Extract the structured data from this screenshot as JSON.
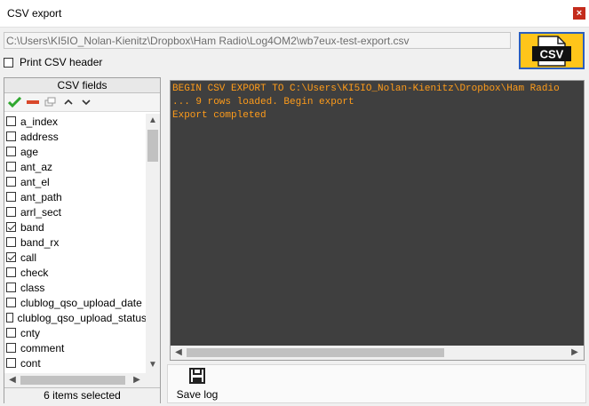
{
  "window": {
    "title": "CSV export",
    "close_glyph": "×"
  },
  "export_path": "C:\\Users\\KI5IO_Nolan-Kienitz\\Dropbox\\Ham Radio\\Log4OM2\\wb7eux-test-export.csv",
  "csv_icon_text": "CSV",
  "print_header": {
    "label": "Print CSV header",
    "checked": false
  },
  "fields": {
    "title": "CSV fields",
    "items": [
      {
        "name": "a_index",
        "checked": false
      },
      {
        "name": "address",
        "checked": false
      },
      {
        "name": "age",
        "checked": false
      },
      {
        "name": "ant_az",
        "checked": false
      },
      {
        "name": "ant_el",
        "checked": false
      },
      {
        "name": "ant_path",
        "checked": false
      },
      {
        "name": "arrl_sect",
        "checked": false
      },
      {
        "name": "band",
        "checked": true
      },
      {
        "name": "band_rx",
        "checked": false
      },
      {
        "name": "call",
        "checked": true
      },
      {
        "name": "check",
        "checked": false
      },
      {
        "name": "class",
        "checked": false
      },
      {
        "name": "clublog_qso_upload_date",
        "checked": false
      },
      {
        "name": "clublog_qso_upload_status",
        "checked": false
      },
      {
        "name": "cnty",
        "checked": false
      },
      {
        "name": "comment",
        "checked": false
      },
      {
        "name": "cont",
        "checked": false
      }
    ],
    "status": "6 items selected"
  },
  "log": {
    "lines": [
      "BEGIN CSV EXPORT TO C:\\Users\\KI5IO_Nolan-Kienitz\\Dropbox\\Ham Radio",
      "... 9 rows loaded. Begin export",
      "Export completed"
    ]
  },
  "save_log_label": "Save log",
  "colors": {
    "log_bg": "#3f3f3f",
    "log_text": "#ff9c1a",
    "csv_icon_bg": "#ffc51a",
    "csv_icon_border": "#2b5ebd"
  }
}
